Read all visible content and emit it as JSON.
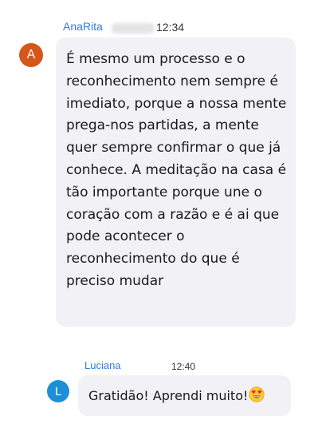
{
  "messages": [
    {
      "avatar_letter": "A",
      "avatar_color": "#d4561a",
      "sender": "AnaRita",
      "time": "12:34",
      "text": "É mesmo um processo e o reconhecimento nem sempre é imediato, porque a nossa mente prega-nos partidas, a mente quer sempre confirmar o que já conhece. A meditação na casa é tão importante porque une o coração com a razão e é ai que pode acontecer o reconhecimento do que é preciso mudar"
    },
    {
      "avatar_letter": "L",
      "avatar_color": "#1d8fd8",
      "sender": "Luciana",
      "time": "12:40",
      "text": "Gratidão! Aprendi muito!",
      "emoji": "heart-eyes-emoji"
    }
  ],
  "colors": {
    "sender_name": "#2f7de1",
    "bubble_bg": "#f2f2f6"
  }
}
